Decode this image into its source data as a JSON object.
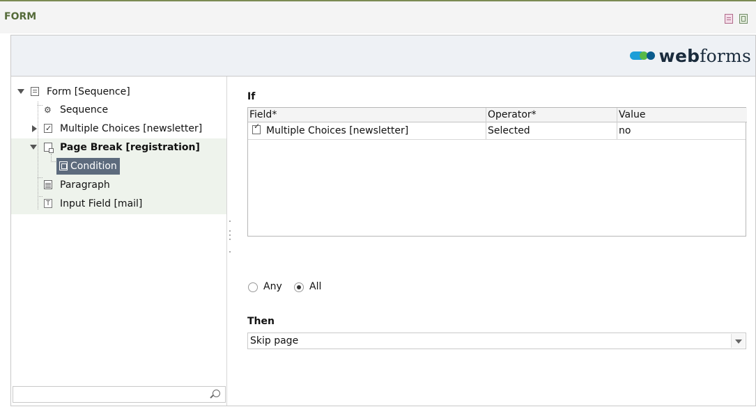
{
  "window": {
    "title": "FORM"
  },
  "header": {
    "logo_bold": "web",
    "logo_light": "forms"
  },
  "tree": {
    "items": [
      {
        "label": "Form [Sequence]"
      },
      {
        "label": "Sequence"
      },
      {
        "label": "Multiple Choices [newsletter]"
      },
      {
        "label": "Page Break [registration]"
      },
      {
        "label": "Condition"
      },
      {
        "label": "Paragraph"
      },
      {
        "label": "Input Field [mail]"
      }
    ],
    "search_placeholder": ""
  },
  "condition": {
    "if_label": "If",
    "columns": [
      "Field*",
      "Operator*",
      "Value"
    ],
    "rows": [
      {
        "field": "Multiple Choices [newsletter]",
        "operator": "Selected",
        "value": "no"
      }
    ],
    "match_options": [
      {
        "label": "Any",
        "selected": false
      },
      {
        "label": "All",
        "selected": true
      }
    ],
    "then_label": "Then",
    "then_value": "Skip page"
  }
}
